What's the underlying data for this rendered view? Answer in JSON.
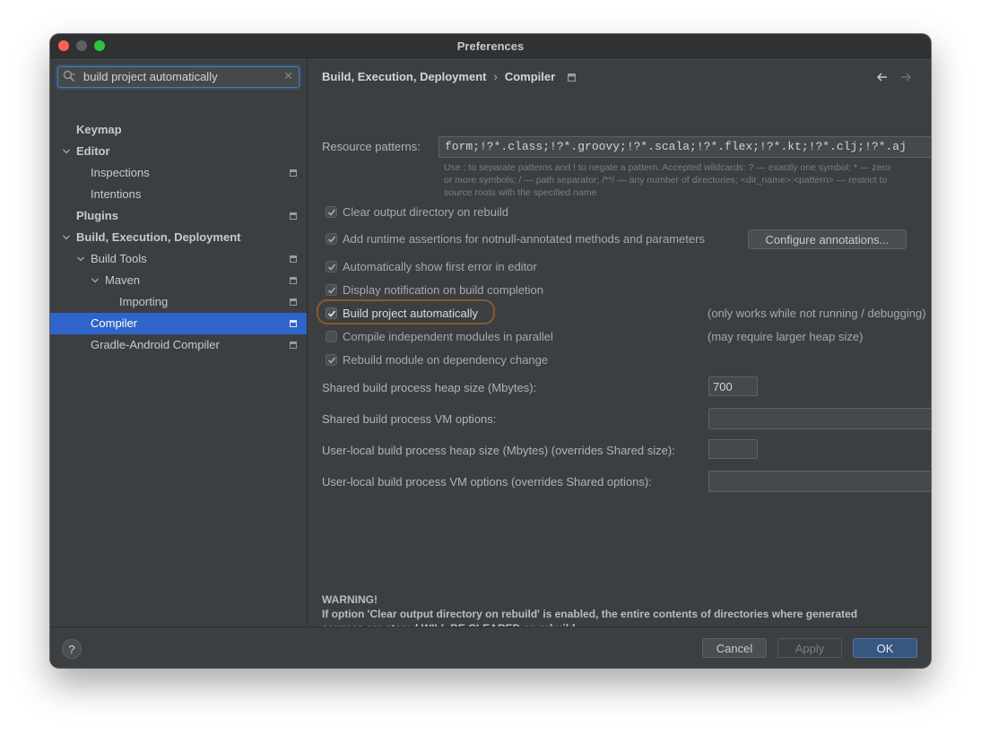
{
  "window": {
    "title": "Preferences"
  },
  "search": {
    "value": "build project automatically",
    "clear_icon": "clear-icon"
  },
  "sidebar": {
    "items": [
      {
        "label": "Keymap"
      },
      {
        "label": "Editor"
      },
      {
        "label": "Inspections"
      },
      {
        "label": "Intentions"
      },
      {
        "label": "Plugins"
      },
      {
        "label": "Build, Execution, Deployment"
      },
      {
        "label": "Build Tools"
      },
      {
        "label": "Maven"
      },
      {
        "label": "Importing"
      },
      {
        "label": "Compiler"
      },
      {
        "label": "Gradle-Android Compiler"
      }
    ],
    "selected": "Compiler"
  },
  "breadcrumb": {
    "parent": "Build, Execution, Deployment",
    "current": "Compiler"
  },
  "compiler": {
    "resource_patterns_label": "Resource patterns:",
    "resource_patterns_value": "form;!?*.class;!?*.groovy;!?*.scala;!?*.flex;!?*.kt;!?*.clj;!?*.aj",
    "hint_lines": [
      "Use ; to separate patterns and ! to negate a pattern. Accepted wildcards: ? — exactly one symbol; * — zero",
      "or more symbols; / — path separator; /**/ — any number of directories; <dir_name>:<pattern> — restrict to",
      "source roots with the specified name"
    ],
    "options": [
      {
        "label": "Clear output directory on rebuild",
        "checked": true
      },
      {
        "label": "Add runtime assertions for notnull-annotated methods and parameters",
        "checked": true
      },
      {
        "label": "Automatically show first error in editor",
        "checked": true
      },
      {
        "label": "Display notification on build completion",
        "checked": true
      },
      {
        "label": "Build project automatically",
        "checked": true
      },
      {
        "label": "Compile independent modules in parallel",
        "checked": false
      },
      {
        "label": "Rebuild module on dependency change",
        "checked": true
      }
    ],
    "configure_annotations_label": "Configure annotations...",
    "note_build_auto": "(only works while not running / debugging)",
    "note_parallel": "(may require larger heap size)",
    "shared_heap_label": "Shared build process heap size (Mbytes):",
    "shared_heap_value": "700",
    "shared_vm_label": "Shared build process VM options:",
    "shared_vm_value": "",
    "user_heap_label": "User-local build process heap size (Mbytes) (overrides Shared size):",
    "user_heap_value": "",
    "user_vm_label": "User-local build process VM options (overrides Shared options):",
    "user_vm_value": "",
    "warning_title": "WARNING!",
    "warning_line1": "If option 'Clear output directory on rebuild' is enabled, the entire contents of directories where generated",
    "warning_line2": "sources are stored WILL BE CLEARED on rebuild."
  },
  "footer": {
    "help_label": "?",
    "cancel_label": "Cancel",
    "apply_label": "Apply",
    "ok_label": "OK"
  },
  "colors": {
    "accent": "#2f65ca",
    "focus_ring": "#8a5a2c",
    "background": "#3c3f41"
  }
}
